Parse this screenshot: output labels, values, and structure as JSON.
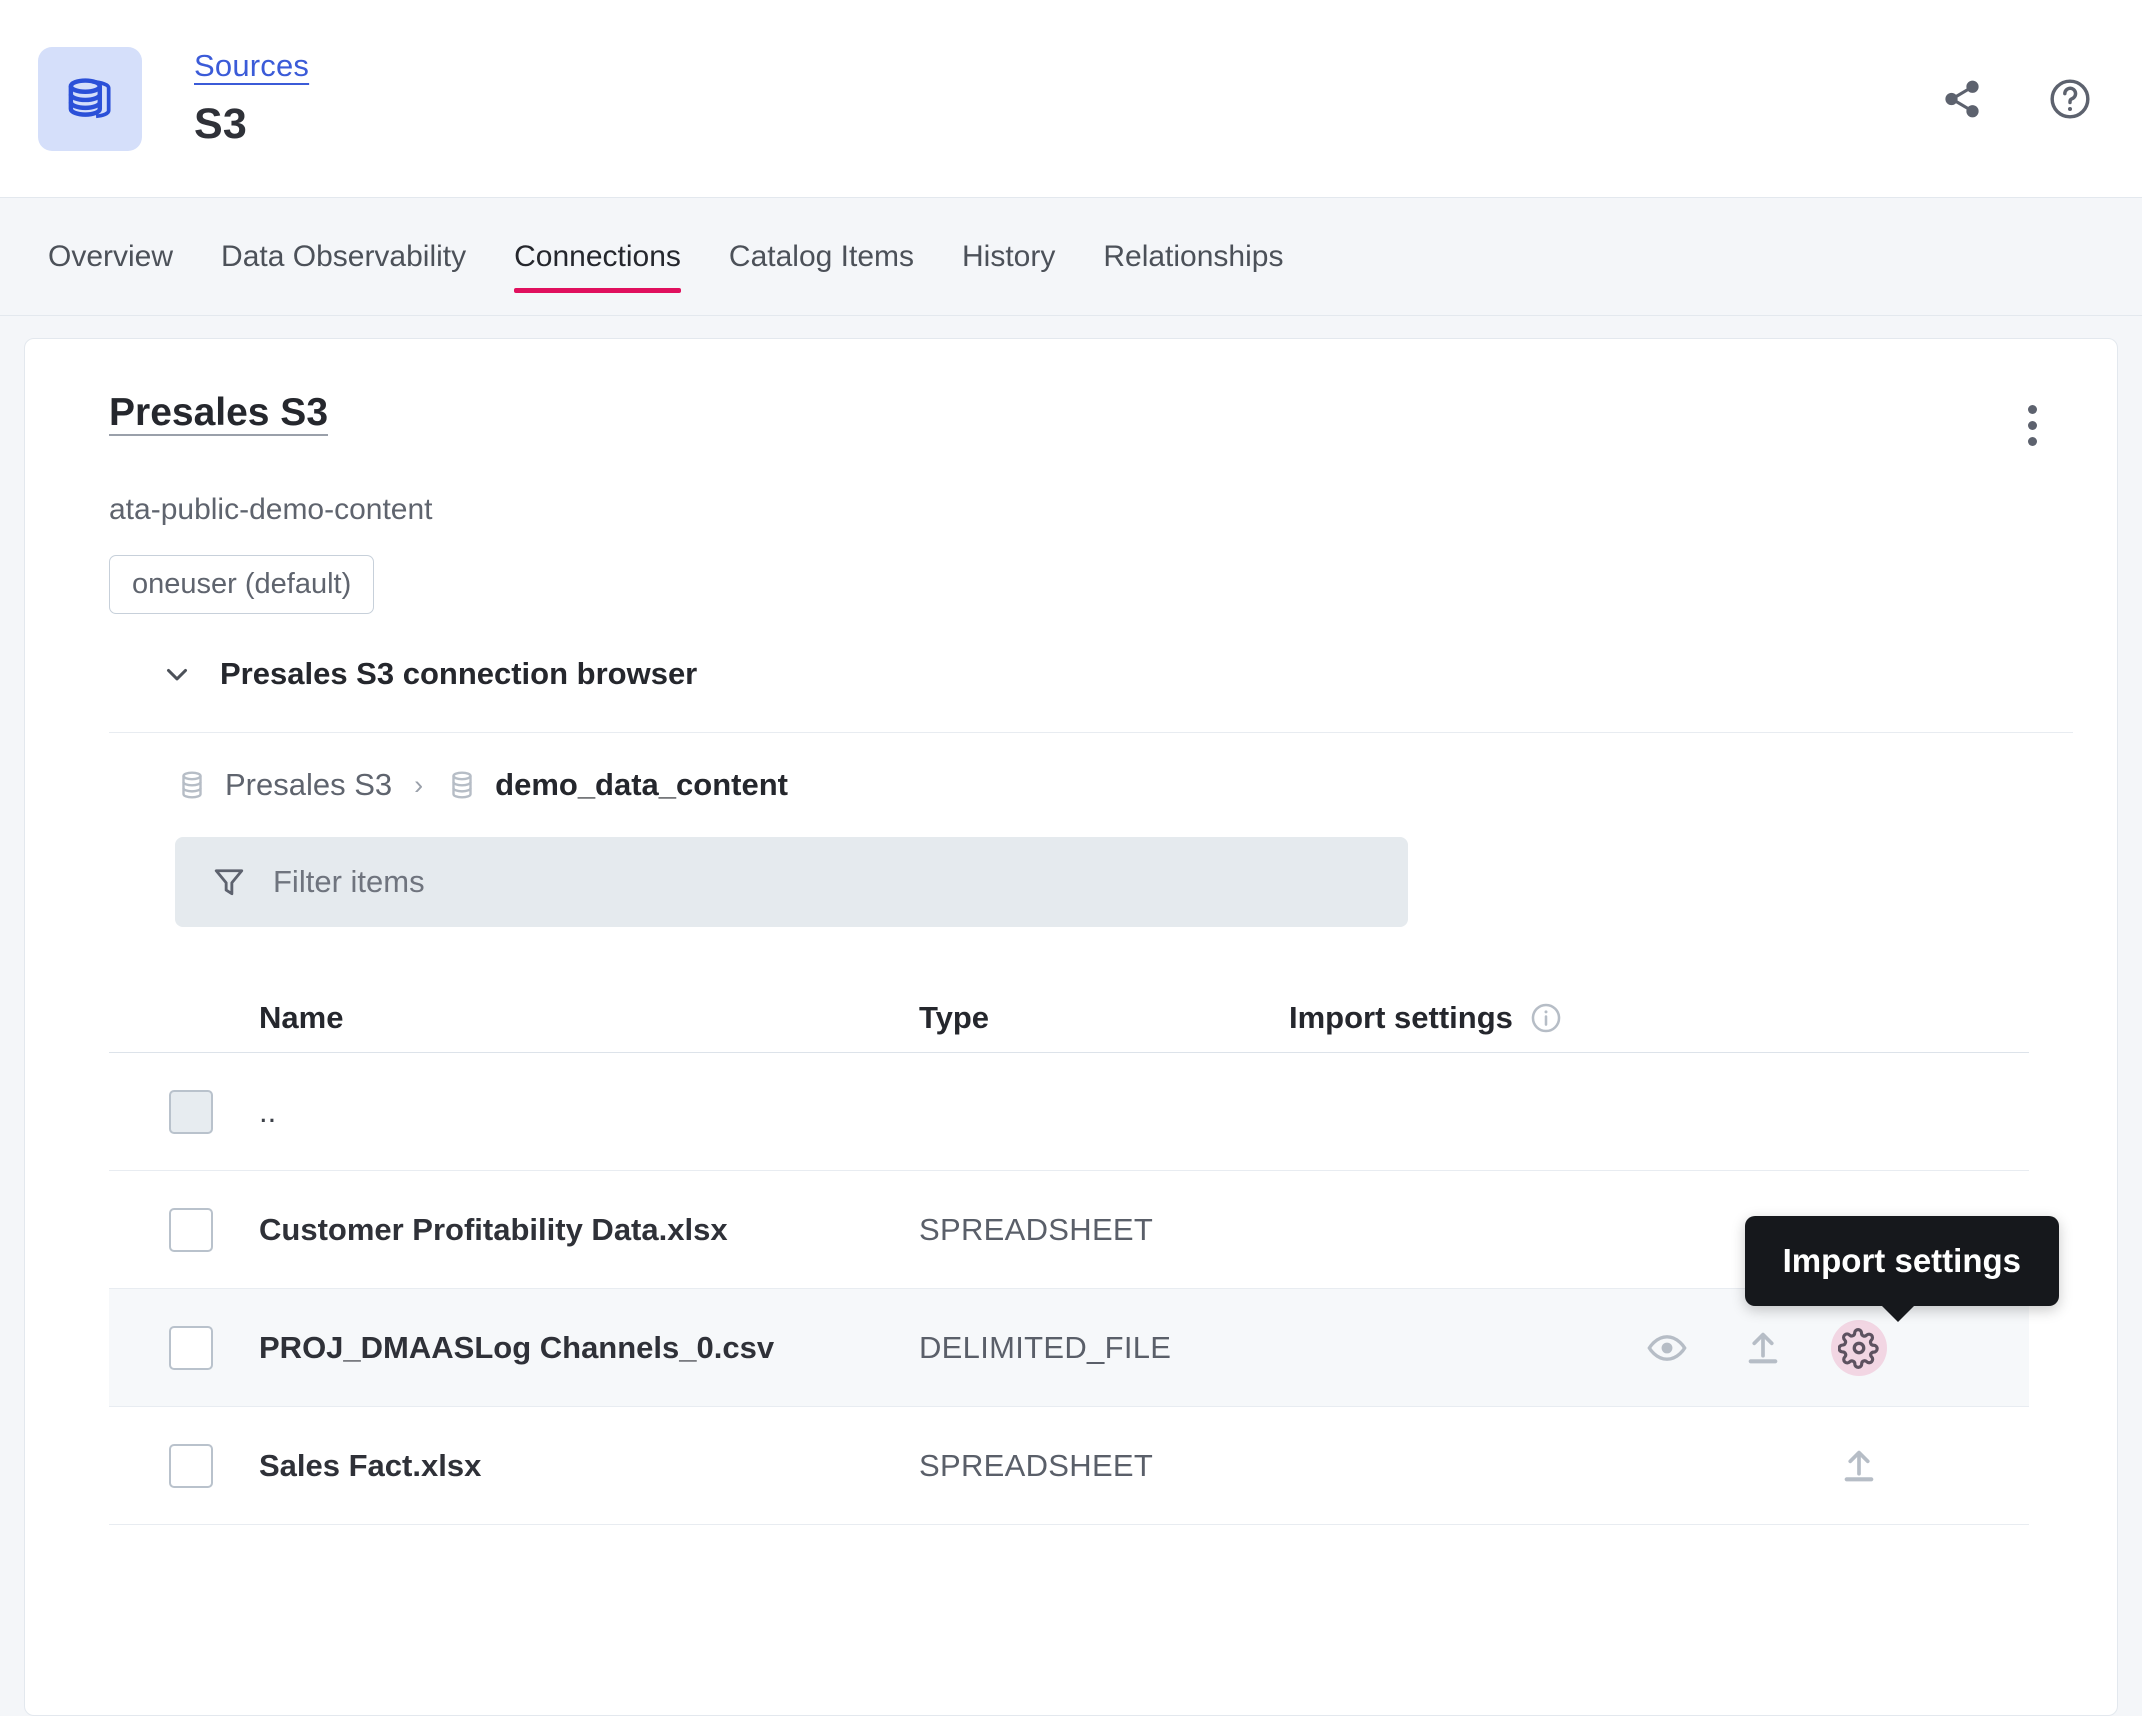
{
  "header": {
    "icon_name": "database-stack-icon",
    "breadcrumb": "Sources",
    "title": "S3",
    "share_icon": "share-icon",
    "help_icon": "help-circle-icon"
  },
  "tabs": [
    {
      "label": "Overview",
      "active": false
    },
    {
      "label": "Data Observability",
      "active": false
    },
    {
      "label": "Connections",
      "active": true
    },
    {
      "label": "Catalog Items",
      "active": false
    },
    {
      "label": "History",
      "active": false
    },
    {
      "label": "Relationships",
      "active": false
    }
  ],
  "connection": {
    "title": "Presales S3",
    "subtitle": "ata-public-demo-content",
    "credential_chip": "oneuser (default)",
    "browser_label": "Presales S3 connection browser",
    "expanded": true,
    "kebab_icon": "more-vertical-icon"
  },
  "breadcrumbs": [
    {
      "label": "Presales S3",
      "icon": "database-icon",
      "current": false
    },
    {
      "label": "demo_data_content",
      "icon": "database-icon",
      "current": true
    }
  ],
  "filter": {
    "placeholder": "Filter items",
    "value": "",
    "icon": "filter-funnel-icon"
  },
  "table": {
    "columns": [
      {
        "key": "name",
        "label": "Name"
      },
      {
        "key": "type",
        "label": "Type"
      },
      {
        "key": "import",
        "label": "Import settings",
        "info_icon": "info-circle-icon"
      }
    ],
    "rows": [
      {
        "name": "..",
        "type": "",
        "checkbox_disabled": true,
        "hovered": false,
        "actions": []
      },
      {
        "name": "Customer Profitability Data.xlsx",
        "type": "SPREADSHEET",
        "checkbox_disabled": false,
        "hovered": false,
        "actions": []
      },
      {
        "name": "PROJ_DMAASLog Channels_0.csv",
        "type": "DELIMITED_FILE",
        "checkbox_disabled": false,
        "hovered": true,
        "actions": [
          "eye-icon",
          "upload-icon",
          "gear-icon"
        ]
      },
      {
        "name": "Sales Fact.xlsx",
        "type": "SPREADSHEET",
        "checkbox_disabled": false,
        "hovered": false,
        "actions": [
          "upload-icon"
        ]
      }
    ]
  },
  "tooltip": {
    "text": "Import settings",
    "visible": true
  },
  "colors": {
    "accent": "#e0105e",
    "link": "#3b5bd8",
    "page_bg": "#f4f6f9",
    "card_bg": "#ffffff",
    "tooltip_bg": "#16181c",
    "highlight": "#f2d6e3"
  }
}
